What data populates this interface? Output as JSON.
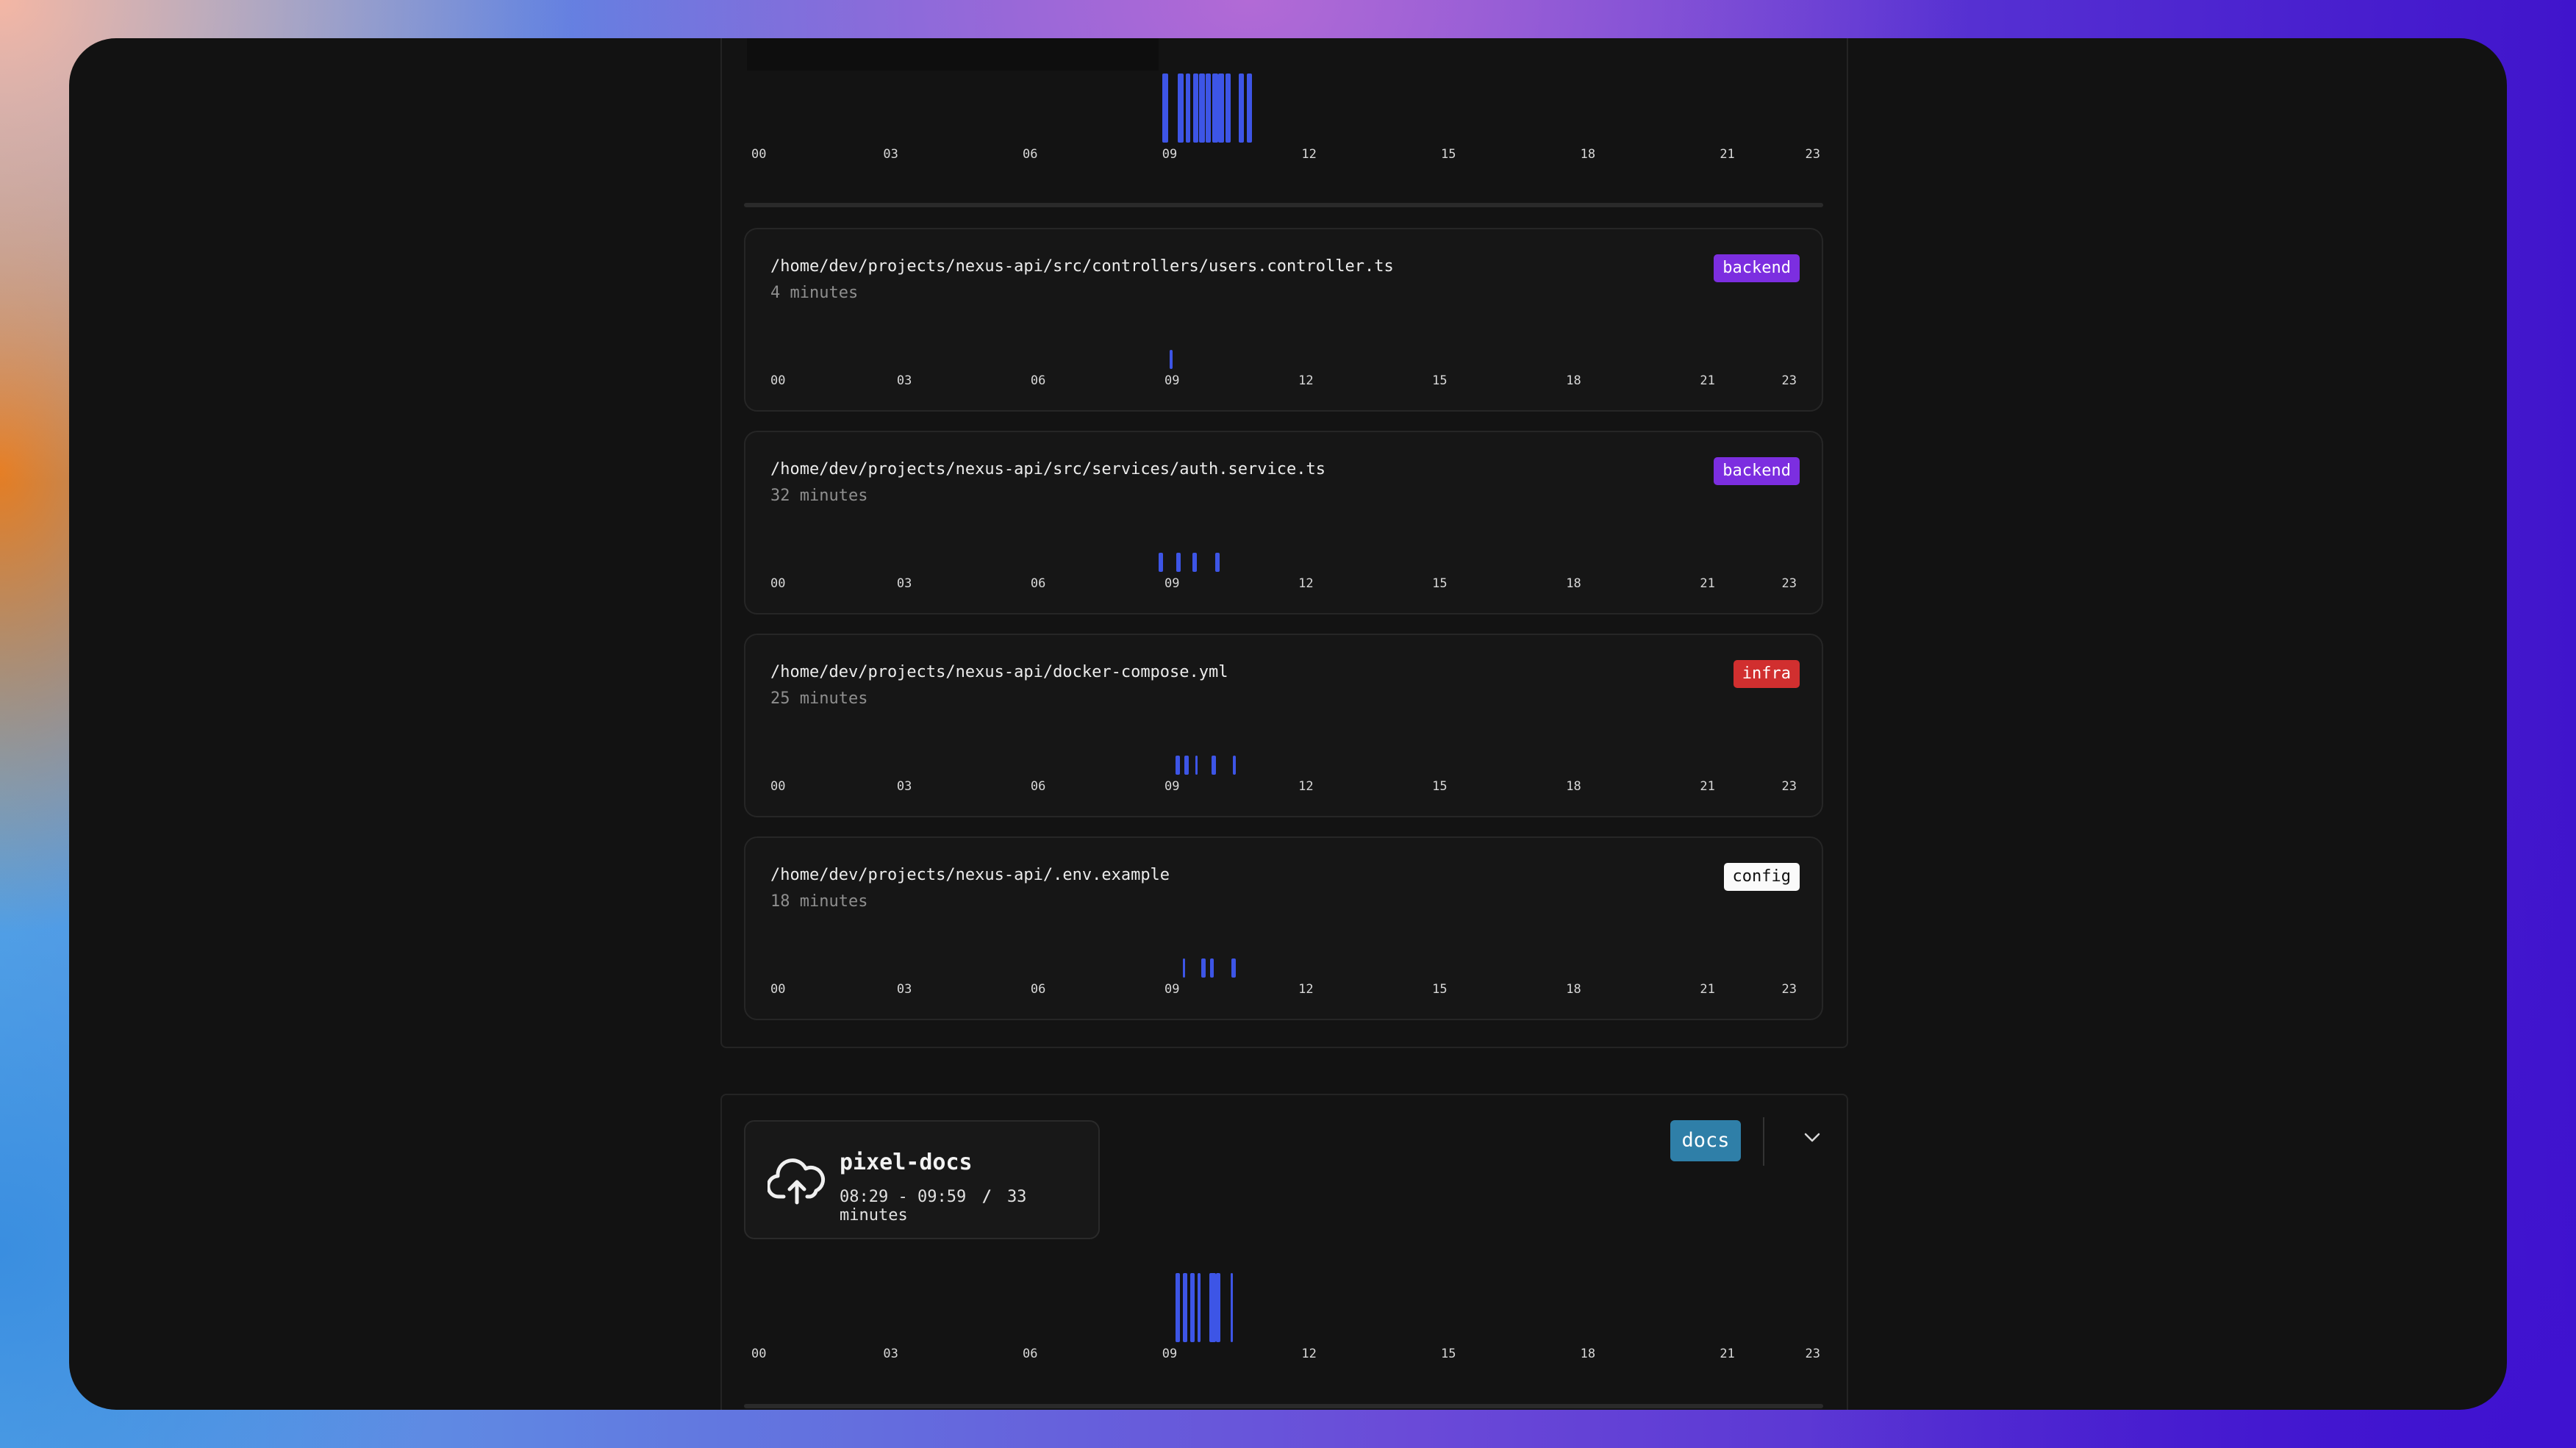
{
  "accent": "#3d55e6",
  "hour_ticks": [
    "00",
    "03",
    "06",
    "09",
    "12",
    "15",
    "18",
    "21",
    "23"
  ],
  "top_summary_timeline": {
    "bars": [
      [
        8.85,
        0.12
      ],
      [
        9.18,
        0.12
      ],
      [
        9.35,
        0.1
      ],
      [
        9.5,
        0.12
      ],
      [
        9.64,
        0.12
      ],
      [
        9.78,
        0.1
      ],
      [
        9.92,
        0.12
      ],
      [
        10.05,
        0.12
      ],
      [
        10.2,
        0.12
      ],
      [
        10.48,
        0.12
      ],
      [
        10.66,
        0.12
      ]
    ]
  },
  "files": [
    {
      "path": "/home/dev/projects/nexus-api/src/controllers/users.controller.ts",
      "duration": "4 minutes",
      "tag": "backend",
      "tag_color": "#7c2ee0",
      "bars": [
        [
          8.95,
          0.07
        ]
      ]
    },
    {
      "path": "/home/dev/projects/nexus-api/src/services/auth.service.ts",
      "duration": "32 minutes",
      "tag": "backend",
      "tag_color": "#7c2ee0",
      "bars": [
        [
          8.7,
          0.1
        ],
        [
          9.1,
          0.1
        ],
        [
          9.45,
          0.1
        ],
        [
          9.97,
          0.1
        ]
      ]
    },
    {
      "path": "/home/dev/projects/nexus-api/docker-compose.yml",
      "duration": "25 minutes",
      "tag": "infra",
      "tag_color": "#d12f2f",
      "bars": [
        [
          9.08,
          0.1
        ],
        [
          9.28,
          0.1
        ],
        [
          9.53,
          0.05
        ],
        [
          9.88,
          0.1
        ],
        [
          10.37,
          0.06
        ]
      ]
    },
    {
      "path": "/home/dev/projects/nexus-api/.env.example",
      "duration": "18 minutes",
      "tag": "config",
      "tag_color": "#fafafa",
      "bars": [
        [
          9.25,
          0.04
        ],
        [
          9.65,
          0.1
        ],
        [
          9.85,
          0.08
        ],
        [
          10.33,
          0.1
        ]
      ]
    }
  ],
  "project": {
    "name": "pixel-docs",
    "time_range": "08:29 - 09:59",
    "separator": "/",
    "duration": "33 minutes",
    "tag": "docs",
    "icon": "cloud-upload-icon",
    "expand_icon": "chevron-down-icon",
    "bars": [
      [
        9.12,
        0.1
      ],
      [
        9.28,
        0.1
      ],
      [
        9.44,
        0.1
      ],
      [
        9.6,
        0.06
      ],
      [
        9.85,
        0.14
      ],
      [
        10.0,
        0.1
      ],
      [
        10.32,
        0.04
      ]
    ]
  }
}
